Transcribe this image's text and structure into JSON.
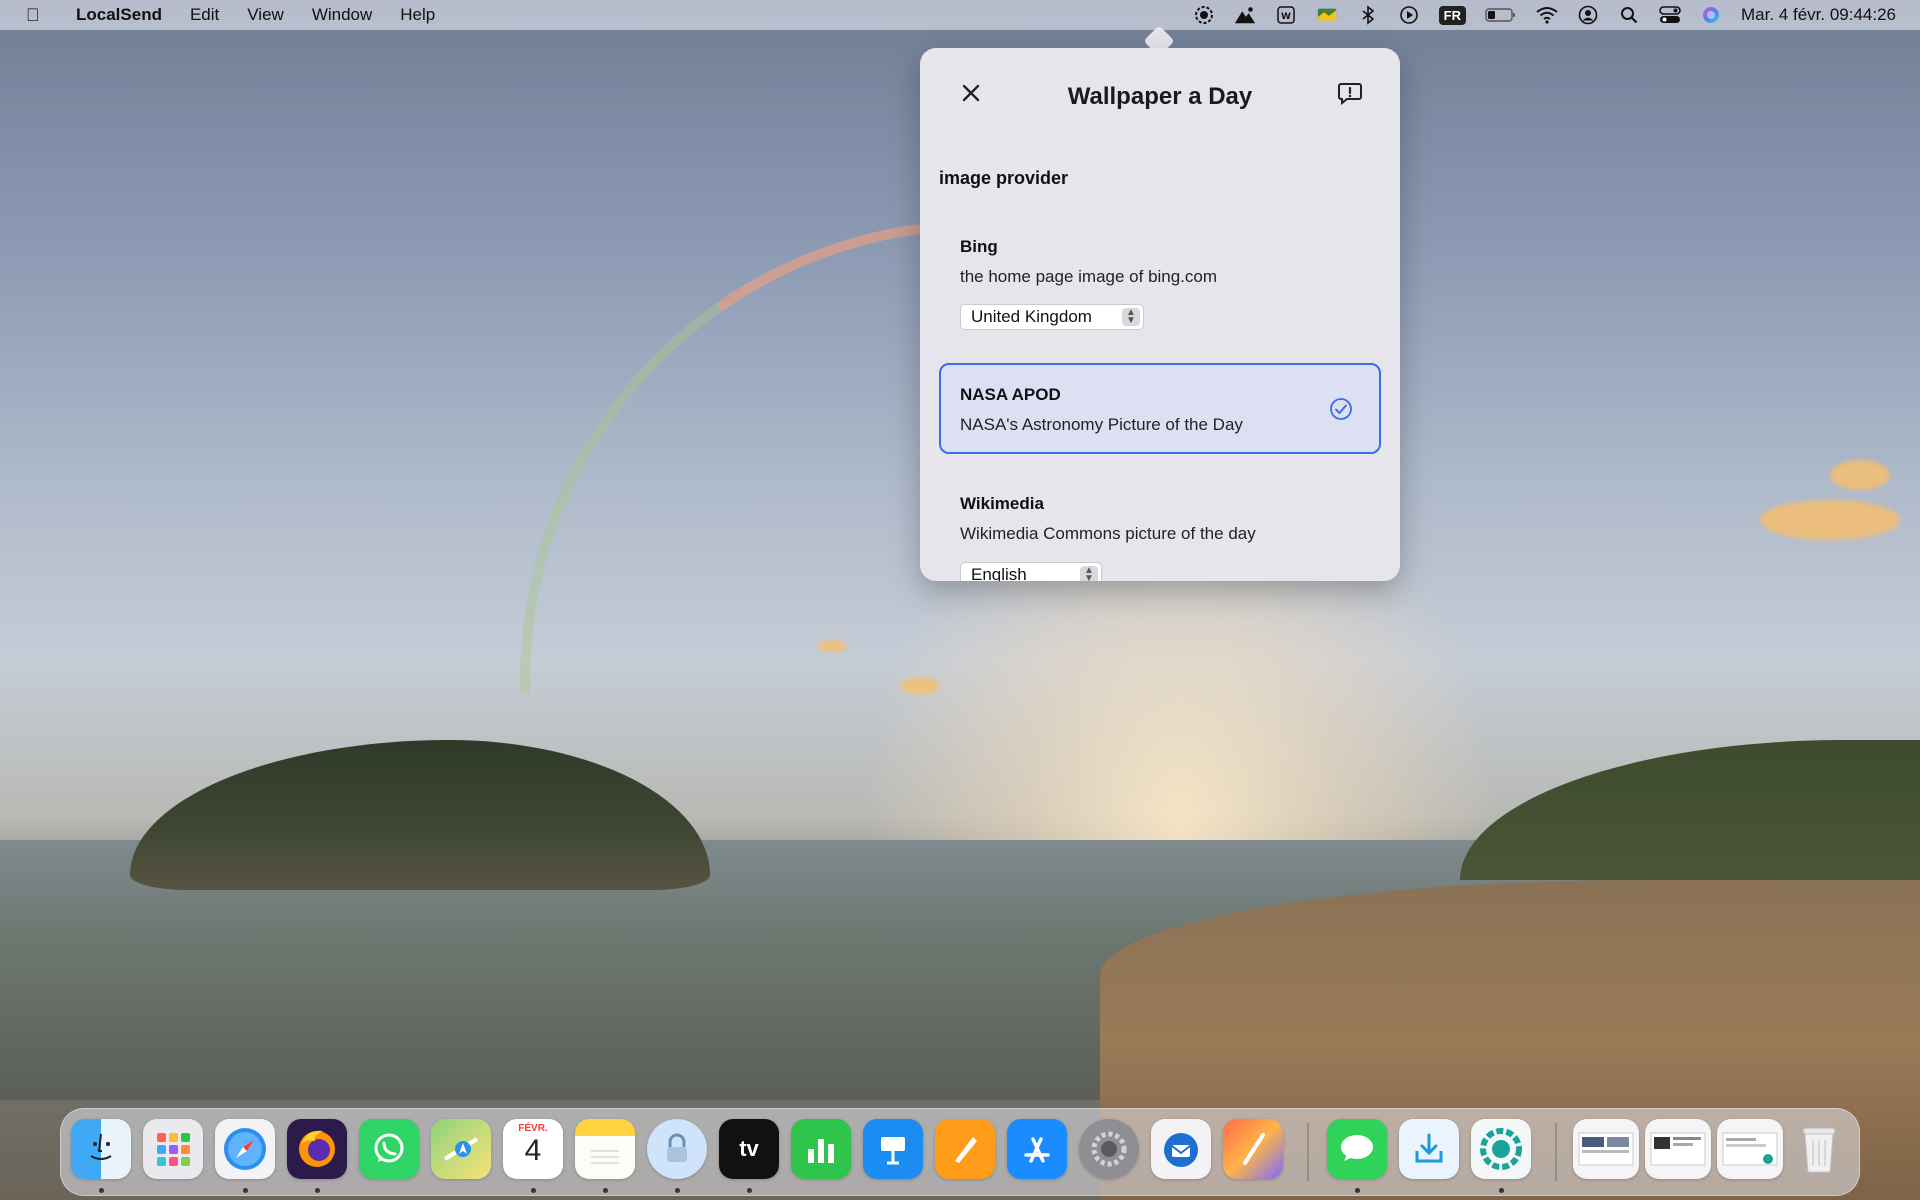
{
  "menubar": {
    "app_name": "LocalSend",
    "menus": [
      "Edit",
      "View",
      "Window",
      "Help"
    ],
    "input_source": "FR",
    "clock": "Mar. 4 févr. 09:44:26"
  },
  "popover": {
    "title": "Wallpaper a Day",
    "section_label": "image provider",
    "providers": [
      {
        "name": "Bing",
        "description": "the home page image of bing.com",
        "option": "United Kingdom",
        "selected": false
      },
      {
        "name": "NASA APOD",
        "description": "NASA's Astronomy Picture of the Day",
        "selected": true
      },
      {
        "name": "Wikimedia",
        "description": "Wikimedia Commons picture of the day",
        "option": "English",
        "selected": false
      }
    ]
  },
  "dock": {
    "calendar_month": "FÉVR.",
    "calendar_day": "4",
    "tv_label": "tv",
    "apps": [
      "finder",
      "launchpad",
      "safari",
      "firefox",
      "whatsapp",
      "maps",
      "calendar",
      "notes",
      "lock",
      "tv",
      "numbers",
      "keynote",
      "pages",
      "app-store",
      "system-settings",
      "thunderbird",
      "pixelmator",
      "messages",
      "localsend",
      "screen-capture"
    ]
  },
  "colors": {
    "accent": "#3b6fe0",
    "popover_bg": "#e6e5ec"
  }
}
